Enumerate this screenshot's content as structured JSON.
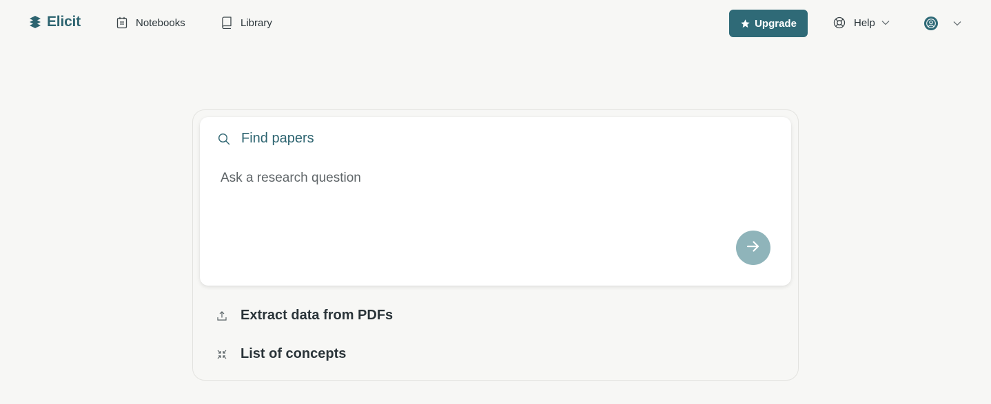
{
  "app": {
    "name": "Elicit",
    "accent_color": "#2f6a77"
  },
  "nav": {
    "items": [
      {
        "label": "Notebooks",
        "icon": "notebook-icon"
      },
      {
        "label": "Library",
        "icon": "book-icon"
      }
    ]
  },
  "header": {
    "upgrade_label": "Upgrade",
    "upgrade_icon": "star-icon",
    "help_label": "Help",
    "help_icon": "lifebuoy-icon",
    "account_icon": "user-avatar-icon"
  },
  "search": {
    "mode_label": "Find papers",
    "mode_icon": "search-icon",
    "placeholder": "Ask a research question",
    "value": "",
    "submit_icon": "arrow-right-icon",
    "submit_color": "#8fb4ba"
  },
  "options": [
    {
      "label": "Extract data from PDFs",
      "icon": "upload-icon"
    },
    {
      "label": "List of concepts",
      "icon": "collapse-arrows-icon"
    }
  ]
}
